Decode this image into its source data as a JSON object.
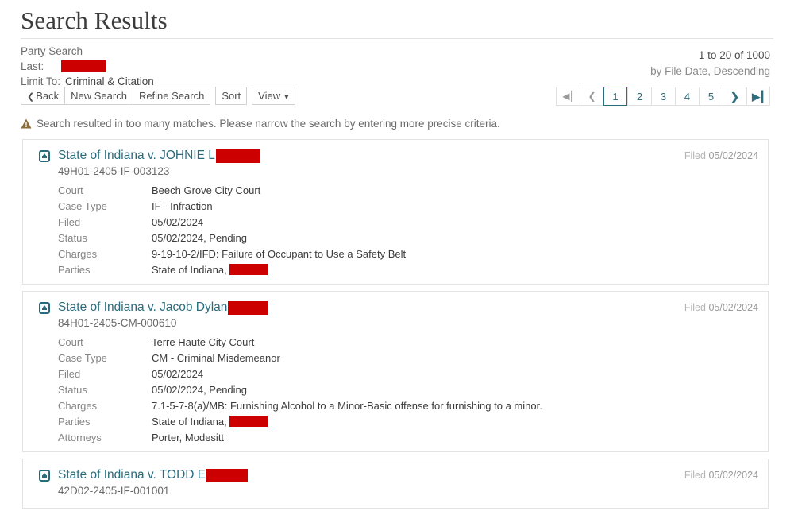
{
  "header": {
    "title": "Search Results",
    "search_type": "Party Search",
    "last_label": "Last:",
    "last_value_redacted": true,
    "limit_label": "Limit To:",
    "limit_value": "Criminal & Citation"
  },
  "toolbar": {
    "back_label": "Back",
    "new_search_label": "New Search",
    "refine_search_label": "Refine Search",
    "sort_label": "Sort",
    "view_label": "View"
  },
  "summary": {
    "count_text": "1 to 20 of 1000",
    "sort_text": "by File Date, Descending"
  },
  "pagination": {
    "first_label": "first-page",
    "prev_label": "previous-page",
    "pages": [
      "1",
      "2",
      "3",
      "4",
      "5"
    ],
    "active_page": "1",
    "next_label": "next-page",
    "last_label": "last-page"
  },
  "warning": {
    "icon": "warning-triangle-icon",
    "text": "Search resulted in too many matches. Please narrow the search by entering more precise criteria."
  },
  "results": [
    {
      "icon": "case-document-icon",
      "title": "State of Indiana v. JOHNIE L",
      "title_redacted": true,
      "case_number": "49H01-2405-IF-003123",
      "filed_label": "Filed",
      "filed_date": "05/02/2024",
      "details": [
        {
          "label": "Court",
          "value": "Beech Grove City Court",
          "redacted": false
        },
        {
          "label": "Case Type",
          "value": "IF - Infraction",
          "redacted": false
        },
        {
          "label": "Filed",
          "value": "05/02/2024",
          "redacted": false
        },
        {
          "label": "Status",
          "value": "05/02/2024, Pending",
          "redacted": false
        },
        {
          "label": "Charges",
          "value": "9-19-10-2/IFD: Failure of Occupant to Use a Safety Belt",
          "redacted": false
        },
        {
          "label": "Parties",
          "value": "State of Indiana,",
          "redacted": true
        }
      ]
    },
    {
      "icon": "case-document-icon",
      "title": "State of Indiana v. Jacob Dylan",
      "title_redacted": true,
      "case_number": "84H01-2405-CM-000610",
      "filed_label": "Filed",
      "filed_date": "05/02/2024",
      "details": [
        {
          "label": "Court",
          "value": "Terre Haute City Court",
          "redacted": false
        },
        {
          "label": "Case Type",
          "value": "CM - Criminal Misdemeanor",
          "redacted": false
        },
        {
          "label": "Filed",
          "value": "05/02/2024",
          "redacted": false
        },
        {
          "label": "Status",
          "value": "05/02/2024, Pending",
          "redacted": false
        },
        {
          "label": "Charges",
          "value": "7.1-5-7-8(a)/MB: Furnishing Alcohol to a Minor-Basic offense for furnishing to a minor.",
          "redacted": false
        },
        {
          "label": "Parties",
          "value": "State of Indiana,",
          "redacted": true
        },
        {
          "label": "Attorneys",
          "value": "Porter, Modesitt",
          "redacted": false
        }
      ]
    },
    {
      "icon": "case-document-icon",
      "title": "State of Indiana v. TODD E",
      "title_redacted": true,
      "case_number": "42D02-2405-IF-001001",
      "filed_label": "Filed",
      "filed_date": "05/02/2024",
      "details": []
    }
  ],
  "colors": {
    "link_teal": "#2a6b7c",
    "redaction_red": "#cc0000",
    "warning_brown": "#8a6d3b",
    "muted_gray": "#858585"
  }
}
